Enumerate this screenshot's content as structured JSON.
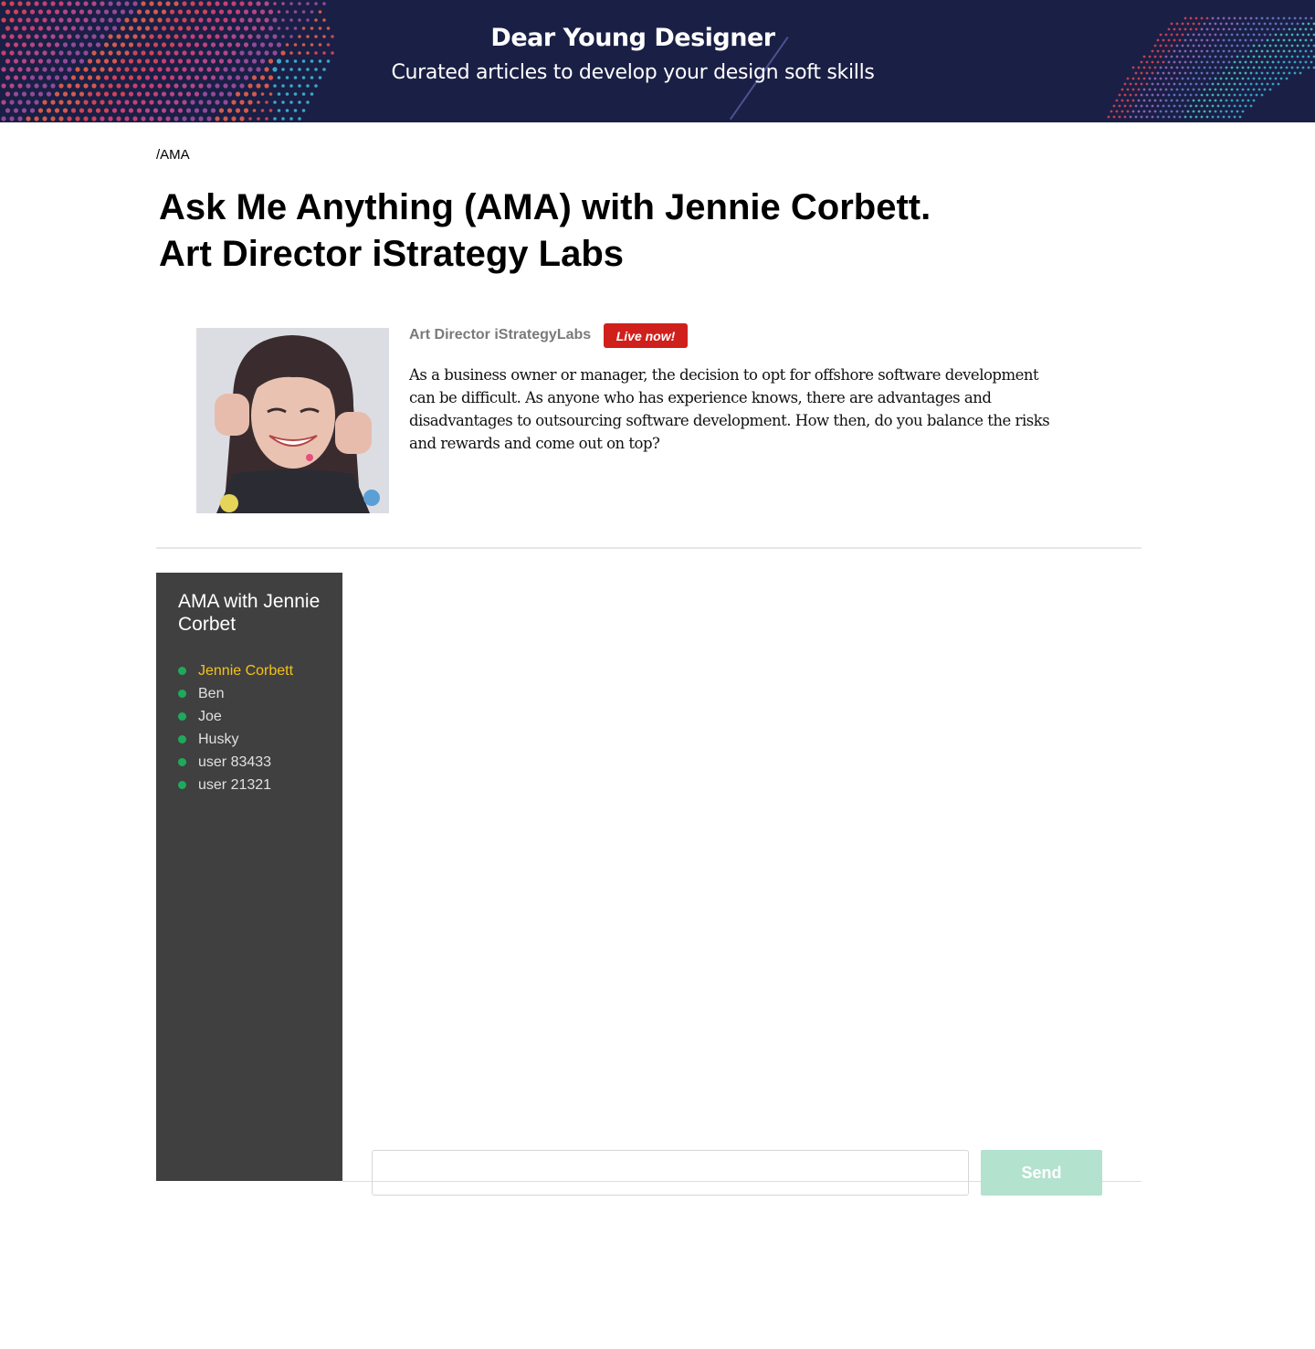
{
  "header": {
    "title": "Dear Young Designer",
    "subtitle": "Curated articles to develop your design soft skills"
  },
  "breadcrumb": "/AMA",
  "page_title_line1": "Ask Me Anything (AMA) with Jennie Corbett.",
  "page_title_line2": "Art Director iStrategy Labs",
  "profile": {
    "role": "Art Director iStrategyLabs",
    "live_badge": "Live now!",
    "description": "As a business owner or manager, the decision to opt for offshore software development can be difficult. As anyone who has experience knows, there are advantages and disadvantages to outsourcing software development. How then, do you balance the risks and rewards and come out on top?"
  },
  "chat": {
    "title": "AMA with Jennie Corbet",
    "users": [
      {
        "name": "Jennie Corbett"
      },
      {
        "name": "Ben"
      },
      {
        "name": "Joe"
      },
      {
        "name": "Husky"
      },
      {
        "name": "user 83433"
      },
      {
        "name": "user 21321"
      }
    ],
    "input_value": "",
    "send_label": "Send"
  },
  "colors": {
    "banner_bg": "#1a1f45",
    "live_badge": "#d0201c",
    "sidebar_bg": "#404040",
    "online_dot": "#1faa5b",
    "active_user": "#f4c21a",
    "send_button": "#b3e2cf"
  }
}
